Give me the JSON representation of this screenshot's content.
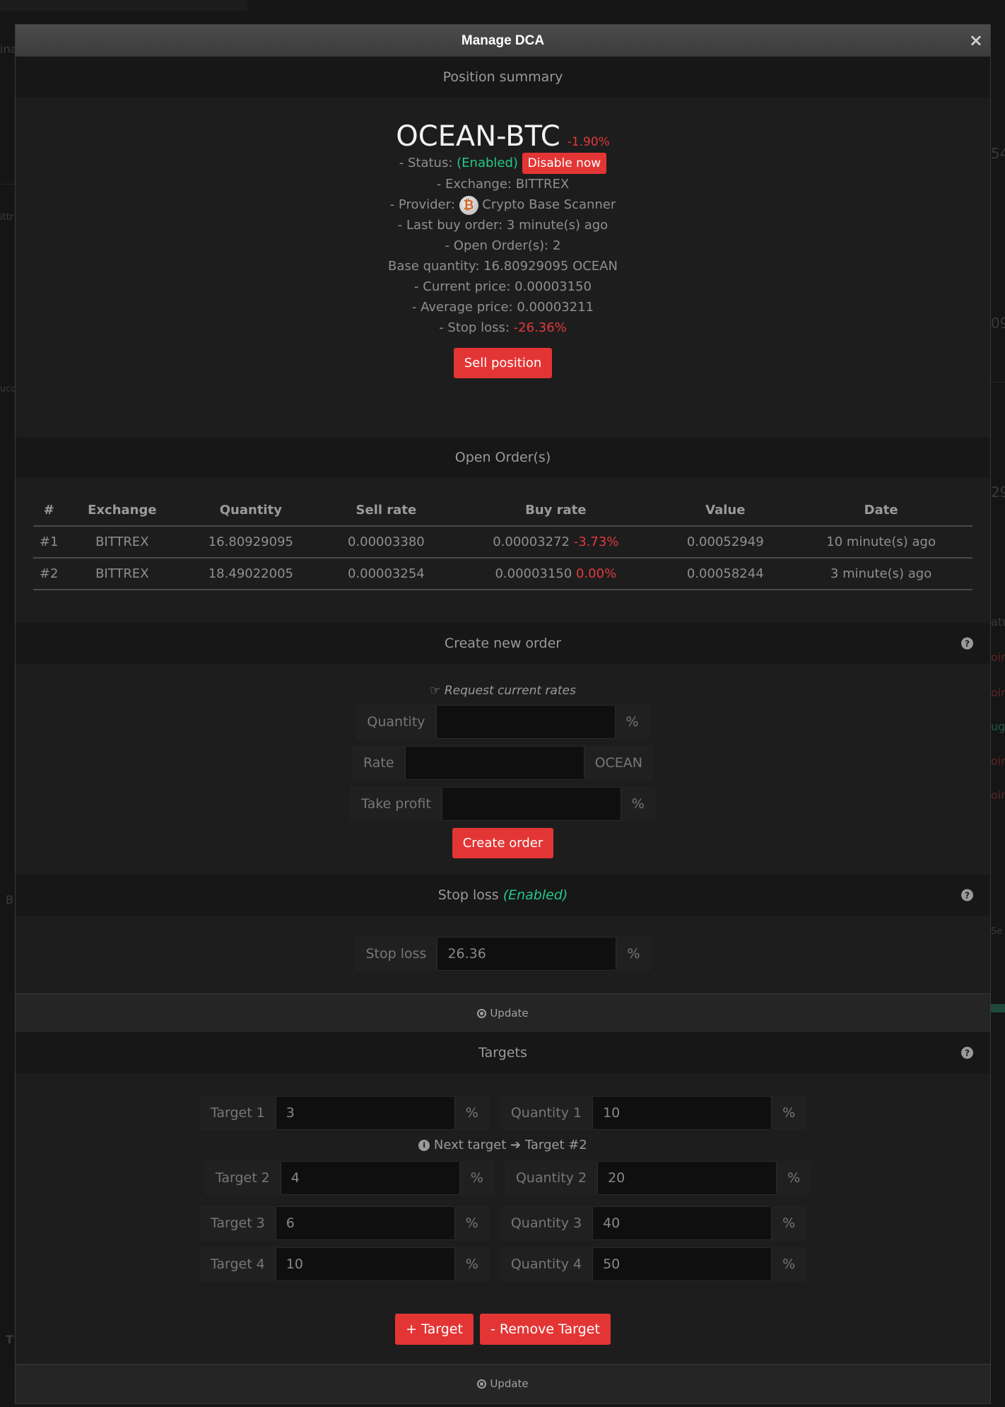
{
  "modal": {
    "title": "Manage DCA",
    "close_label": "×"
  },
  "summary": {
    "section_title": "Position summary",
    "pair": "OCEAN-BTC",
    "pair_change": "-1.90%",
    "status_prefix": "- Status:",
    "status_value": "(Enabled)",
    "disable_button": "Disable now",
    "exchange": "- Exchange: BITTREX",
    "provider_prefix": "- Provider:",
    "provider_name": "Crypto Base Scanner",
    "last_buy": "- Last buy order: 3 minute(s) ago",
    "open_orders": "- Open Order(s): 2",
    "base_quantity": "Base quantity: 16.80929095 OCEAN",
    "current_price": "- Current price: 0.00003150",
    "average_price": "- Average price: 0.00003211",
    "stop_loss_prefix": "- Stop loss:",
    "stop_loss_value": "-26.36%",
    "sell_button": "Sell position"
  },
  "orders": {
    "section_title": "Open Order(s)",
    "headers": [
      "#",
      "Exchange",
      "Quantity",
      "Sell rate",
      "Buy rate",
      "Value",
      "Date"
    ],
    "rows": [
      {
        "num": "#1",
        "exchange": "BITTREX",
        "quantity": "16.80929095",
        "sell_rate": "0.00003380",
        "buy_rate": "0.00003272",
        "buy_change": "-3.73%",
        "value": "0.00052949",
        "date": "10 minute(s) ago"
      },
      {
        "num": "#2",
        "exchange": "BITTREX",
        "quantity": "18.49022005",
        "sell_rate": "0.00003254",
        "buy_rate": "0.00003150",
        "buy_change": "0.00%",
        "value": "0.00058244",
        "date": "3 minute(s) ago"
      }
    ]
  },
  "create_order": {
    "section_title": "Create new order",
    "request_rates": "Request current rates",
    "quantity_label": "Quantity",
    "quantity_value": "",
    "quantity_unit": "%",
    "rate_label": "Rate",
    "rate_value": "",
    "rate_unit": "OCEAN",
    "take_profit_label": "Take profit",
    "take_profit_value": "",
    "take_profit_unit": "%",
    "create_button": "Create order"
  },
  "stop_loss": {
    "section_title": "Stop loss",
    "status": "(Enabled)",
    "label": "Stop loss",
    "value": "26.36",
    "unit": "%",
    "update_label": "Update"
  },
  "targets": {
    "section_title": "Targets",
    "next_target_text": "Next target",
    "next_target_value": "Target #2",
    "items": [
      {
        "target_label": "Target 1",
        "target_value": "3",
        "target_unit": "%",
        "qty_label": "Quantity 1",
        "qty_value": "10",
        "qty_unit": "%"
      },
      {
        "target_label": "Target 2",
        "target_value": "4",
        "target_unit": "%",
        "qty_label": "Quantity 2",
        "qty_value": "20",
        "qty_unit": "%"
      },
      {
        "target_label": "Target 3",
        "target_value": "6",
        "target_unit": "%",
        "qty_label": "Quantity 3",
        "qty_value": "40",
        "qty_unit": "%"
      },
      {
        "target_label": "Target 4",
        "target_value": "10",
        "target_unit": "%",
        "qty_label": "Quantity 4",
        "qty_value": "50",
        "qty_unit": "%"
      }
    ],
    "add_button": "+ Target",
    "remove_button": "- Remove Target",
    "update_label": "Update"
  },
  "background": {
    "fragments": [
      "ina",
      "54",
      "ittr",
      "09",
      "ucc",
      "29",
      "atu",
      "oin",
      "oin",
      "ug",
      "oin",
      "oin",
      "B",
      "Se",
      "T"
    ]
  },
  "colors": {
    "accent_red": "#e43535",
    "positive_green": "#22c98a",
    "modal_bg": "#1d1d1d"
  }
}
